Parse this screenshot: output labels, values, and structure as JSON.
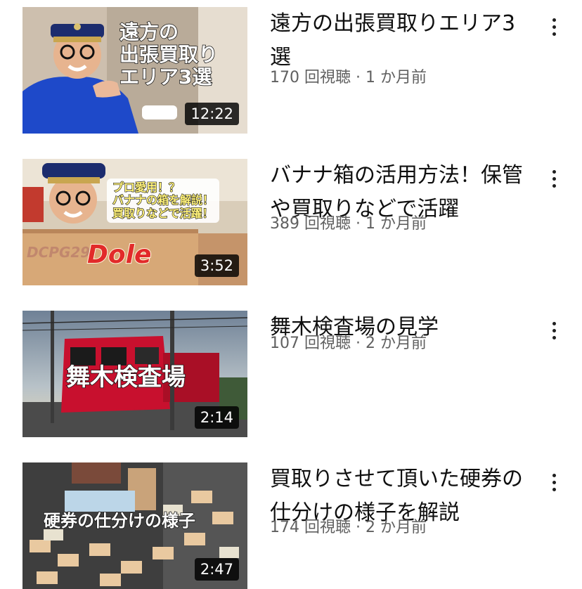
{
  "videos": [
    {
      "thumb_text": "遠方の\n出張買取り\nエリア3選",
      "duration": "12:22",
      "title": "遠方の出張買取りエリア3選",
      "views": "170 回視聴",
      "sep": "·",
      "age": "1 か月前"
    },
    {
      "thumb_text": "プロ愛用！？\nバナナの箱を解説！\n買取りなどで活躍！",
      "thumb_logo": "Dole",
      "thumb_code": "DCPG29",
      "duration": "3:52",
      "title": "バナナ箱の活用方法！保管や買取りなどで活躍",
      "views": "389 回視聴",
      "sep": "·",
      "age": "1 か月前"
    },
    {
      "thumb_text": "舞木検査場",
      "duration": "2:14",
      "title": "舞木検査場の見学",
      "views": "107 回視聴",
      "sep": "·",
      "age": "2 か月前"
    },
    {
      "thumb_text": "硬券の仕分けの様子",
      "duration": "2:47",
      "title": "買取りさせて頂いた硬券の仕分けの様子を解説",
      "views": "174 回視聴",
      "sep": "·",
      "age": "2 か月前"
    }
  ],
  "icons": {
    "more": "more-vert-icon"
  }
}
